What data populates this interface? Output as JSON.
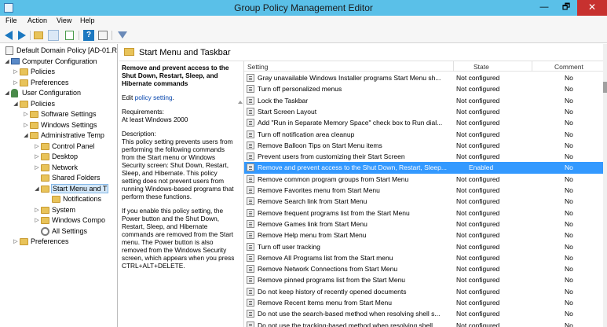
{
  "window": {
    "title": "Group Policy Management Editor",
    "min_label": "—",
    "max_label": "🗗",
    "close_label": "✕"
  },
  "menu": [
    "File",
    "Action",
    "View",
    "Help"
  ],
  "tree": [
    {
      "label": "Default Domain Policy [AD-01.R",
      "icon": "document-icon",
      "indent": 0,
      "expander": ""
    },
    {
      "label": "Computer Configuration",
      "icon": "computer-icon",
      "indent": 1,
      "expander": "◢"
    },
    {
      "label": "Policies",
      "icon": "folder-icon",
      "indent": 2,
      "expander": "▷"
    },
    {
      "label": "Preferences",
      "icon": "folder-icon",
      "indent": 2,
      "expander": "▷"
    },
    {
      "label": "User Configuration",
      "icon": "user-icon",
      "indent": 1,
      "expander": "◢"
    },
    {
      "label": "Policies",
      "icon": "folder-icon",
      "indent": 2,
      "expander": "◢"
    },
    {
      "label": "Software Settings",
      "icon": "folder-icon",
      "indent": 3,
      "expander": "▷"
    },
    {
      "label": "Windows Settings",
      "icon": "folder-icon",
      "indent": 3,
      "expander": "▷"
    },
    {
      "label": "Administrative Temp",
      "icon": "folder-icon",
      "indent": 3,
      "expander": "◢"
    },
    {
      "label": "Control Panel",
      "icon": "folder-icon",
      "indent": 4,
      "expander": "▷"
    },
    {
      "label": "Desktop",
      "icon": "folder-icon",
      "indent": 4,
      "expander": "▷"
    },
    {
      "label": "Network",
      "icon": "folder-icon",
      "indent": 4,
      "expander": "▷"
    },
    {
      "label": "Shared Folders",
      "icon": "folder-icon",
      "indent": 4,
      "expander": ""
    },
    {
      "label": "Start Menu and T",
      "icon": "folder-icon",
      "indent": 4,
      "expander": "◢",
      "selected": true
    },
    {
      "label": "Notifications",
      "icon": "folder-icon",
      "indent": 5,
      "expander": ""
    },
    {
      "label": "System",
      "icon": "folder-icon",
      "indent": 4,
      "expander": "▷"
    },
    {
      "label": "Windows Compo",
      "icon": "folder-icon",
      "indent": 4,
      "expander": "▷"
    },
    {
      "label": "All Settings",
      "icon": "gear-icon",
      "indent": 4,
      "expander": ""
    },
    {
      "label": "Preferences",
      "icon": "folder-icon",
      "indent": 2,
      "expander": "▷"
    }
  ],
  "section": {
    "title": "Start Menu and Taskbar"
  },
  "description": {
    "heading": "Remove and prevent access to the Shut Down, Restart, Sleep, and Hibernate commands",
    "edit_prefix": "Edit ",
    "edit_link": "policy setting",
    "edit_suffix": ".",
    "requirements_label": "Requirements:",
    "requirements_value": "At least Windows 2000",
    "description_label": "Description:",
    "description_text": "This policy setting prevents users from performing the following commands from the Start menu or Windows Security screen: Shut Down, Restart, Sleep, and Hibernate. This policy setting does not prevent users from running Windows-based programs that perform these functions.",
    "paragraph2": "If you enable this policy setting, the Power button and the Shut Down, Restart, Sleep, and Hibernate commands are removed from the Start menu. The Power button is also removed from the Windows Security screen, which appears when you press CTRL+ALT+DELETE."
  },
  "table": {
    "columns": {
      "setting": "Setting",
      "state": "State",
      "comment": "Comment"
    },
    "rows": [
      {
        "name": "Gray unavailable Windows Installer programs Start Menu sh...",
        "state": "Not configured",
        "comment": "No"
      },
      {
        "name": "Turn off personalized menus",
        "state": "Not configured",
        "comment": "No"
      },
      {
        "name": "Lock the Taskbar",
        "state": "Not configured",
        "comment": "No"
      },
      {
        "name": "Start Screen Layout",
        "state": "Not configured",
        "comment": "No"
      },
      {
        "name": "Add \"Run in Separate Memory Space\" check box to Run dial...",
        "state": "Not configured",
        "comment": "No"
      },
      {
        "name": "Turn off notification area cleanup",
        "state": "Not configured",
        "comment": "No"
      },
      {
        "name": "Remove Balloon Tips on Start Menu items",
        "state": "Not configured",
        "comment": "No"
      },
      {
        "name": "Prevent users from customizing their Start Screen",
        "state": "Not configured",
        "comment": "No"
      },
      {
        "name": "Remove and prevent access to the Shut Down, Restart, Sleep...",
        "state": "Enabled",
        "comment": "No",
        "selected": true
      },
      {
        "name": "Remove common program groups from Start Menu",
        "state": "Not configured",
        "comment": "No"
      },
      {
        "name": "Remove Favorites menu from Start Menu",
        "state": "Not configured",
        "comment": "No"
      },
      {
        "name": "Remove Search link from Start Menu",
        "state": "Not configured",
        "comment": "No"
      },
      {
        "name": "Remove frequent programs list from the Start Menu",
        "state": "Not configured",
        "comment": "No"
      },
      {
        "name": "Remove Games link from Start Menu",
        "state": "Not configured",
        "comment": "No"
      },
      {
        "name": "Remove Help menu from Start Menu",
        "state": "Not configured",
        "comment": "No"
      },
      {
        "name": "Turn off user tracking",
        "state": "Not configured",
        "comment": "No"
      },
      {
        "name": "Remove All Programs list from the Start menu",
        "state": "Not configured",
        "comment": "No"
      },
      {
        "name": "Remove Network Connections from Start Menu",
        "state": "Not configured",
        "comment": "No"
      },
      {
        "name": "Remove pinned programs list from the Start Menu",
        "state": "Not configured",
        "comment": "No"
      },
      {
        "name": "Do not keep history of recently opened documents",
        "state": "Not configured",
        "comment": "No"
      },
      {
        "name": "Remove Recent Items menu from Start Menu",
        "state": "Not configured",
        "comment": "No"
      },
      {
        "name": "Do not use the search-based method when resolving shell s...",
        "state": "Not configured",
        "comment": "No"
      },
      {
        "name": "Do not use the tracking-based method when resolving shell ...",
        "state": "Not configured",
        "comment": "No"
      }
    ]
  }
}
